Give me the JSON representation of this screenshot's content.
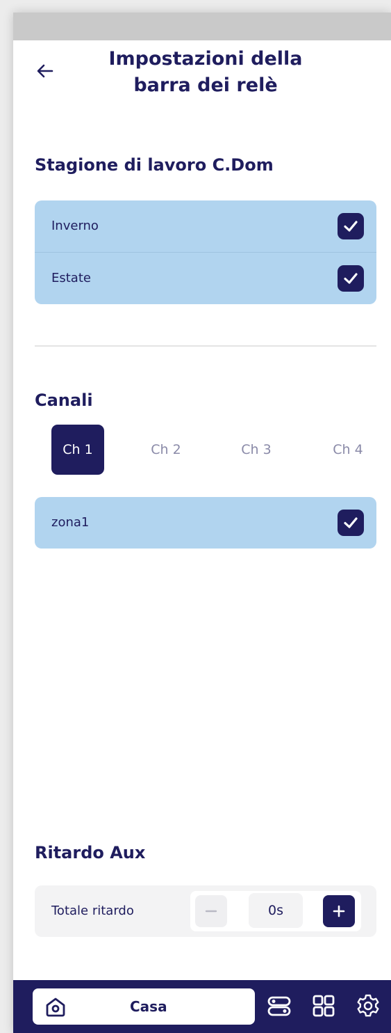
{
  "header": {
    "title": "Impostazioni della barra dei relè"
  },
  "season": {
    "title": "Stagione di lavoro C.Dom",
    "options": [
      {
        "label": "Inverno",
        "checked": true
      },
      {
        "label": "Estate",
        "checked": true
      }
    ]
  },
  "channels": {
    "title": "Canali",
    "tabs": [
      "Ch 1",
      "Ch 2",
      "Ch 3",
      "Ch 4"
    ],
    "active_tab": "Ch 1",
    "zones": [
      {
        "label": "zona1",
        "checked": true
      }
    ]
  },
  "aux_delay": {
    "title": "Ritardo Aux",
    "label": "Totale ritardo",
    "value": "0s"
  },
  "nav": {
    "home_label": "Casa",
    "icons": [
      "home-icon",
      "toggles-icon",
      "grid-icon",
      "settings-icon"
    ]
  },
  "colors": {
    "primary": "#1f1d5e",
    "card_blue": "#b1d4ef",
    "card_grey": "#f3f3f4",
    "status_bar": "#c9c9c9"
  }
}
